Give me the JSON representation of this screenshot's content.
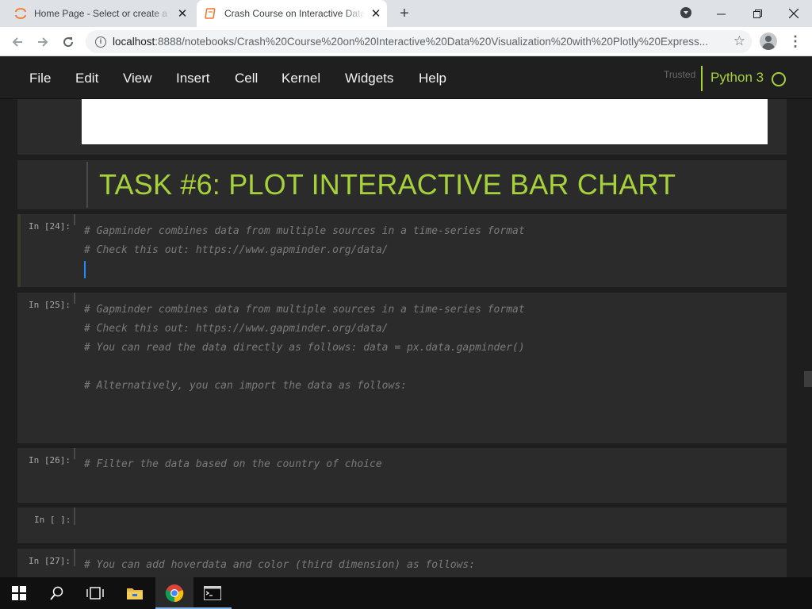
{
  "browser": {
    "tabs": [
      {
        "title": "Home Page - Select or create a notebook",
        "active": false
      },
      {
        "title": "Crash Course on Interactive Data Visualization",
        "active": true
      }
    ],
    "new_tab": "+",
    "url_host": "localhost",
    "url_path": ":8888/notebooks/Crash%20Course%20on%20Interactive%20Data%20Visualization%20with%20Plotly%20Express...",
    "icons": [
      "back-icon",
      "forward-icon",
      "reload-icon",
      "info-icon",
      "star-icon",
      "profile-icon",
      "menu-icon"
    ]
  },
  "jupyter": {
    "menu": [
      "File",
      "Edit",
      "View",
      "Insert",
      "Cell",
      "Kernel",
      "Widgets",
      "Help"
    ],
    "trusted": "Trusted",
    "kernel": "Python 3",
    "accent": "#a6d13a"
  },
  "notebook": {
    "heading": "TASK #6: PLOT INTERACTIVE BAR CHART",
    "cells": [
      {
        "prompt": "In [24]:",
        "lines": [
          "# Gapminder combines data from multiple sources in a time-series format",
          "# Check this out: https://www.gapminder.org/data/"
        ]
      },
      {
        "prompt": "In [25]:",
        "lines": [
          "# Gapminder combines data from multiple sources in a time-series format",
          "# Check this out: https://www.gapminder.org/data/",
          "# You can read the data directly as follows: data = px.data.gapminder()",
          "",
          "# Alternatively, you can import the data as follows:"
        ]
      },
      {
        "prompt": "In [26]:",
        "lines": [
          "# Filter the data based on the country of choice"
        ]
      },
      {
        "prompt": "In [ ]:",
        "lines": []
      },
      {
        "prompt": "In [27]:",
        "lines": [
          "# You can add hoverdata and color (third dimension) as follows:"
        ]
      }
    ]
  },
  "taskbar": {
    "items": [
      "windows-start-icon",
      "search-icon",
      "task-view-icon",
      "file-explorer-icon",
      "chrome-icon",
      "terminal-icon"
    ]
  }
}
